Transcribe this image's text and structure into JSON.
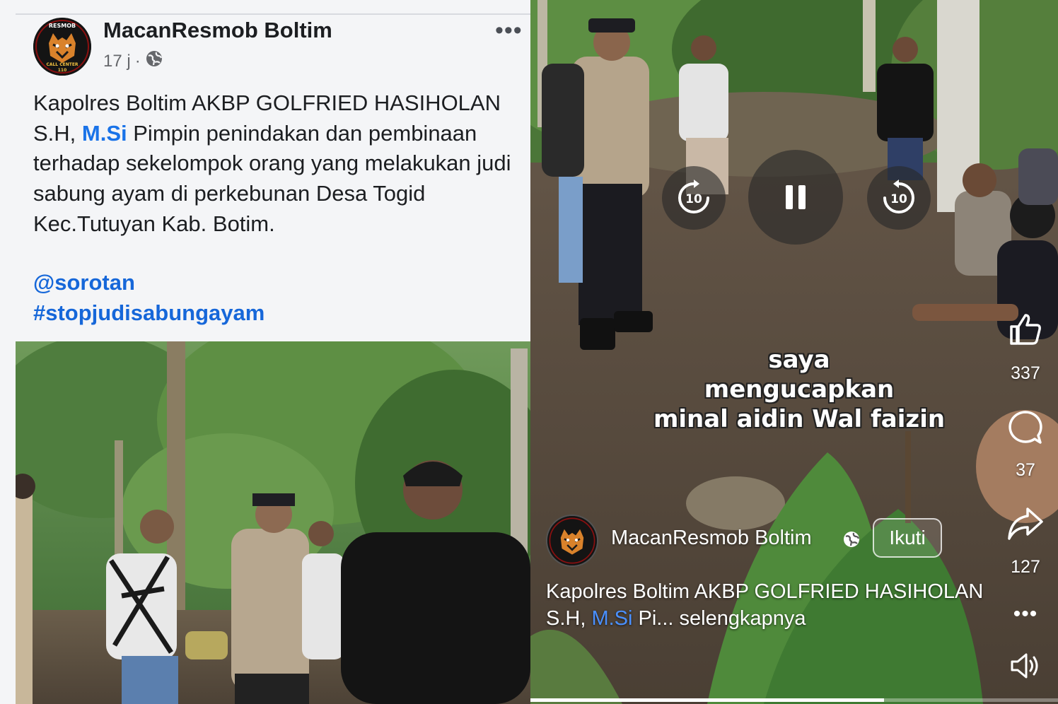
{
  "post": {
    "author": "MacanResmob Boltim",
    "time": "17 j",
    "separator": "·",
    "more": "•••",
    "text_before": "Kapolres Boltim AKBP GOLFRIED HASIHOLAN S.H, ",
    "text_highlight": "M.Si",
    "text_after": " Pimpin penindakan dan pembinaan terhadap sekelompok orang yang melakukan judi sabung ayam di perkebunan Desa Togid Kec.Tutuyan Kab. Botim.",
    "mention": "@sorotan",
    "hashtag": "#stopjudisabungayam",
    "avatar_top_text": "RESMOB",
    "avatar_bottom_text": "CALL CENTER",
    "avatar_number": "110"
  },
  "video": {
    "rewind_label": "10",
    "forward_label": "10",
    "caption_line1": "saya",
    "caption_line2": "mengucapkan",
    "caption_line3": "minal aidin Wal faizin",
    "likes": "337",
    "comments": "37",
    "shares": "127",
    "more": "•••",
    "channel_name": "MacanResmob Boltim",
    "follow_label": "Ikuti",
    "desc_before": "Kapolres Boltim AKBP GOLFRIED HASIHOLAN S.H, ",
    "desc_highlight": "M.Si",
    "desc_after": " Pi... selengkapnya",
    "progress": 0.67
  },
  "colors": {
    "link_blue": "#1667d9",
    "text_dark": "#1c1e21",
    "meta_gray": "#65676b"
  },
  "icons": [
    "globe-icon",
    "more-icon",
    "rewind-10-icon",
    "pause-icon",
    "forward-10-icon",
    "like-icon",
    "comment-icon",
    "share-icon",
    "volume-icon"
  ]
}
